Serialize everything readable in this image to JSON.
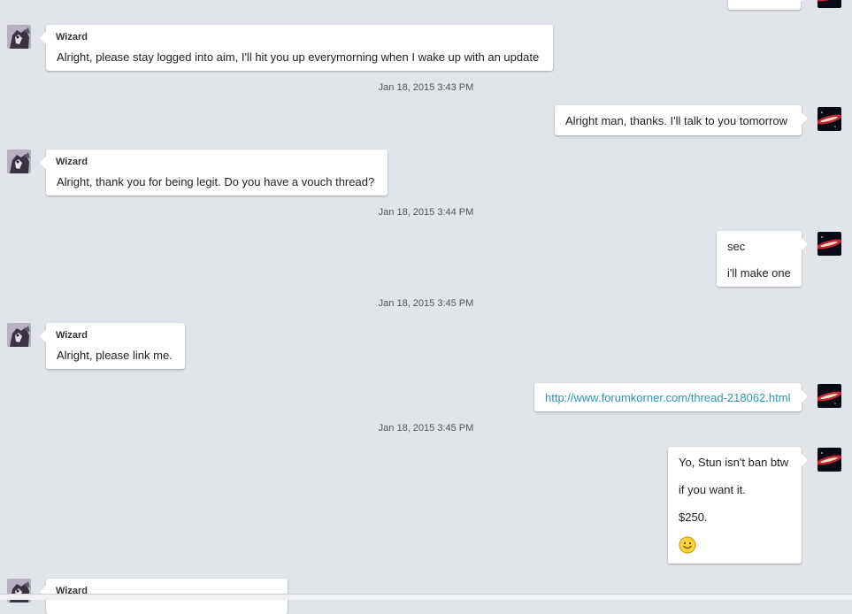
{
  "conversation": {
    "items": [
      {
        "kind": "in",
        "sender": "Wizard",
        "lines": [
          "Alright, please stay logged into aim, I'll hit you up everymorning when I wake up with an update"
        ]
      },
      {
        "kind": "timestamp",
        "text": "Jan 18, 2015 3:43 PM"
      },
      {
        "kind": "out",
        "lines": [
          "Alright man, thanks. I'll talk to you tomorrow"
        ]
      },
      {
        "kind": "in",
        "sender": "Wizard",
        "lines": [
          "Alright, thank you for being legit. Do you have a vouch thread?"
        ]
      },
      {
        "kind": "timestamp",
        "text": "Jan 18, 2015 3:44 PM"
      },
      {
        "kind": "out",
        "lines": [
          "sec",
          "i'll make one"
        ]
      },
      {
        "kind": "timestamp",
        "text": "Jan 18, 2015 3:45 PM"
      },
      {
        "kind": "in",
        "sender": "Wizard",
        "lines": [
          "Alright, please link me."
        ]
      },
      {
        "kind": "out",
        "link": "http://www.forumkorner.com/thread-218062.html"
      },
      {
        "kind": "timestamp",
        "text": "Jan 18, 2015 3:45 PM"
      },
      {
        "kind": "out",
        "lines": [
          "Yo, Stun isn't ban btw",
          "if you want it.",
          "$250."
        ],
        "emoji": "smiley-icon"
      },
      {
        "kind": "in",
        "sender": "Wizard",
        "lines": []
      }
    ]
  },
  "colors": {
    "background": "#e1e4e8",
    "link": "#2a97b9",
    "bubble": "#ffffff"
  }
}
